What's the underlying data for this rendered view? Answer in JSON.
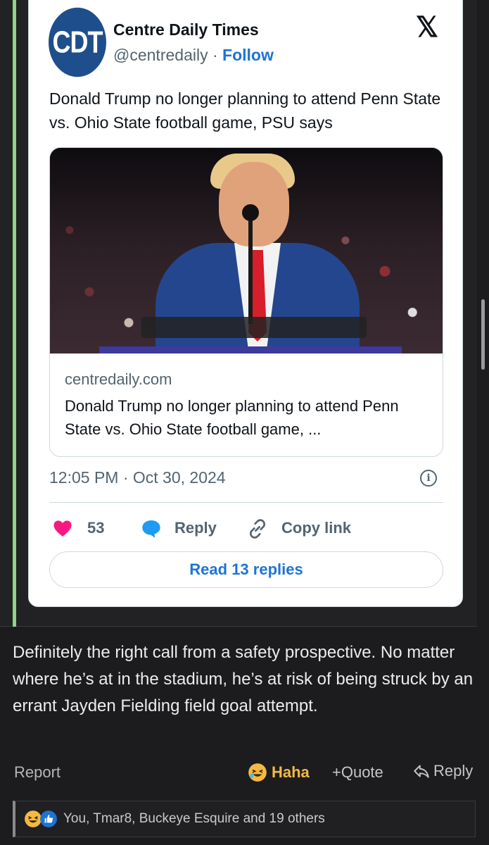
{
  "tweet": {
    "avatar_text": "CDT",
    "author_name": "Centre Daily Times",
    "handle": "@centredaily",
    "separator": " · ",
    "follow_label": "Follow",
    "x_logo": "𝕏",
    "text": "Donald Trump no longer planning to attend Penn State vs. Ohio State football game, PSU says",
    "link_card": {
      "domain": "centredaily.com",
      "title": "Donald Trump no longer planning to attend Penn State vs. Ohio State football game, ..."
    },
    "timestamp": "12:05 PM · Oct 30, 2024",
    "info_glyph": "i",
    "likes": "53",
    "reply_label": "Reply",
    "copy_link_label": "Copy link",
    "read_replies_label": "Read 13 replies"
  },
  "post": {
    "body": "Definitely the right call from a safety prospective. No matter where he’s at in the stadium, he’s at risk of being struck by an errant Jayden Fielding field goal attempt.",
    "report_label": "Report",
    "haha_label": "Haha",
    "quote_label": "+Quote",
    "reply_label": "Reply",
    "reactions_text": "You, Tmar8, Buckeye Esquire and 19 others"
  },
  "colors": {
    "quote_bar": "#8fd48b",
    "link_blue": "#1d74d4",
    "heart": "#f91880",
    "haha": "#f5b942"
  }
}
